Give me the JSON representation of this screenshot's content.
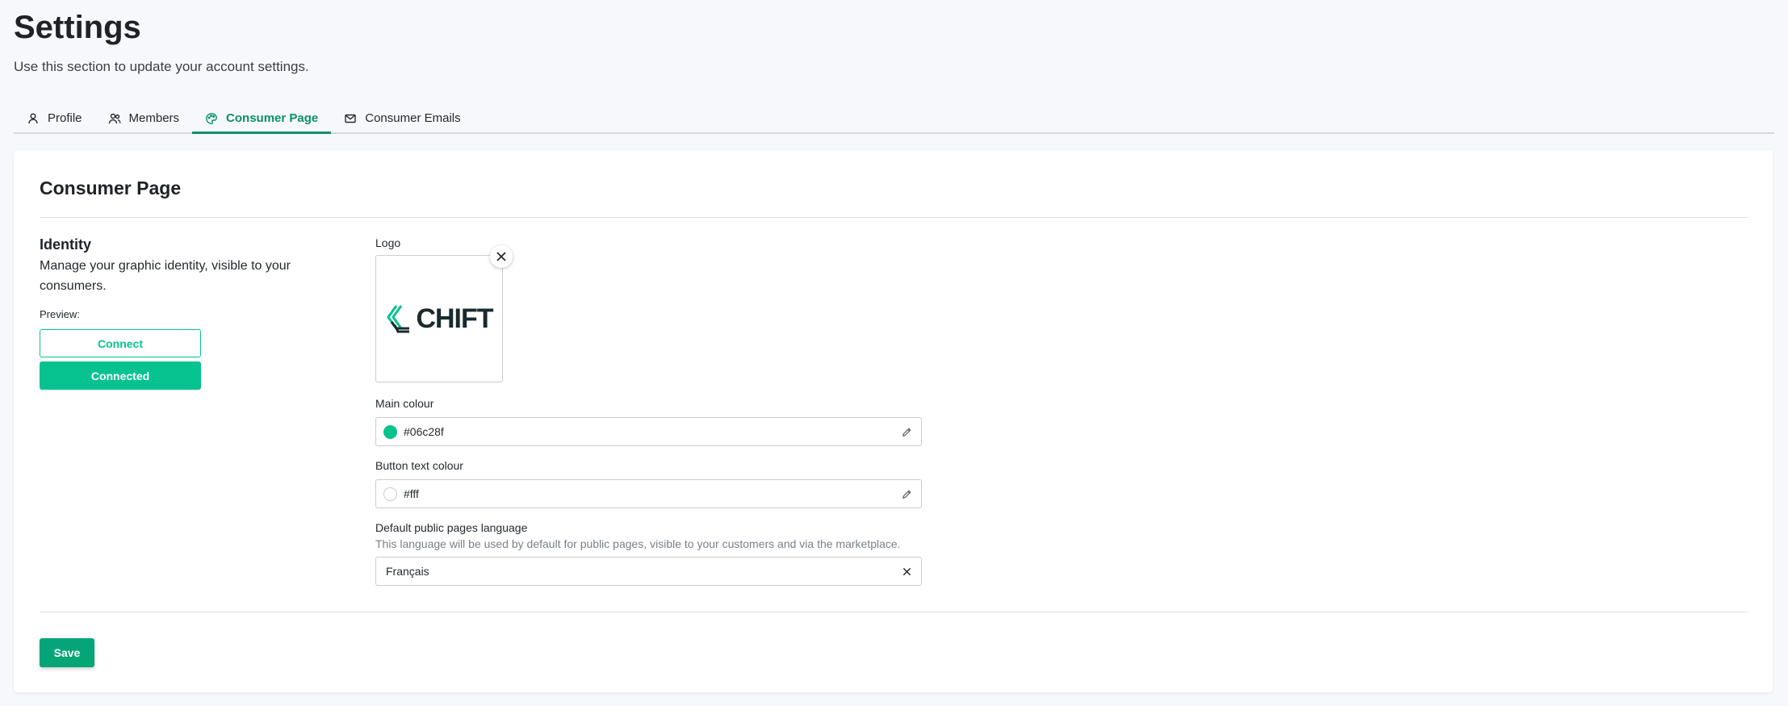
{
  "header": {
    "title": "Settings",
    "subtitle": "Use this section to update your account settings."
  },
  "tabs": [
    {
      "label": "Profile",
      "icon": "user-icon",
      "active": false
    },
    {
      "label": "Members",
      "icon": "users-icon",
      "active": false
    },
    {
      "label": "Consumer Page",
      "icon": "palette-icon",
      "active": true
    },
    {
      "label": "Consumer Emails",
      "icon": "mail-icon",
      "active": false
    }
  ],
  "card": {
    "title": "Consumer Page",
    "identity": {
      "heading": "Identity",
      "description": "Manage your graphic identity, visible to your consumers.",
      "preview_label": "Preview:",
      "connect_label": "Connect",
      "connected_label": "Connected"
    },
    "logo": {
      "label": "Logo",
      "wordmark": "CHIFT",
      "remove_icon": "close-icon"
    },
    "main_colour": {
      "label": "Main colour",
      "value": "#06c28f",
      "swatch": "#06c28f",
      "icon": "pencil-icon"
    },
    "button_text_colour": {
      "label": "Button text colour",
      "value": "#fff",
      "swatch": "#ffffff",
      "icon": "pencil-icon"
    },
    "language": {
      "label": "Default public pages language",
      "help": "This language will be used by default for public pages, visible to your customers and via the marketplace.",
      "value": "Français",
      "clear_icon": "close-icon"
    },
    "save_label": "Save"
  },
  "colors": {
    "accent": "#06c28f",
    "active_tab": "#0a8f6a",
    "save_button": "#06a578"
  }
}
